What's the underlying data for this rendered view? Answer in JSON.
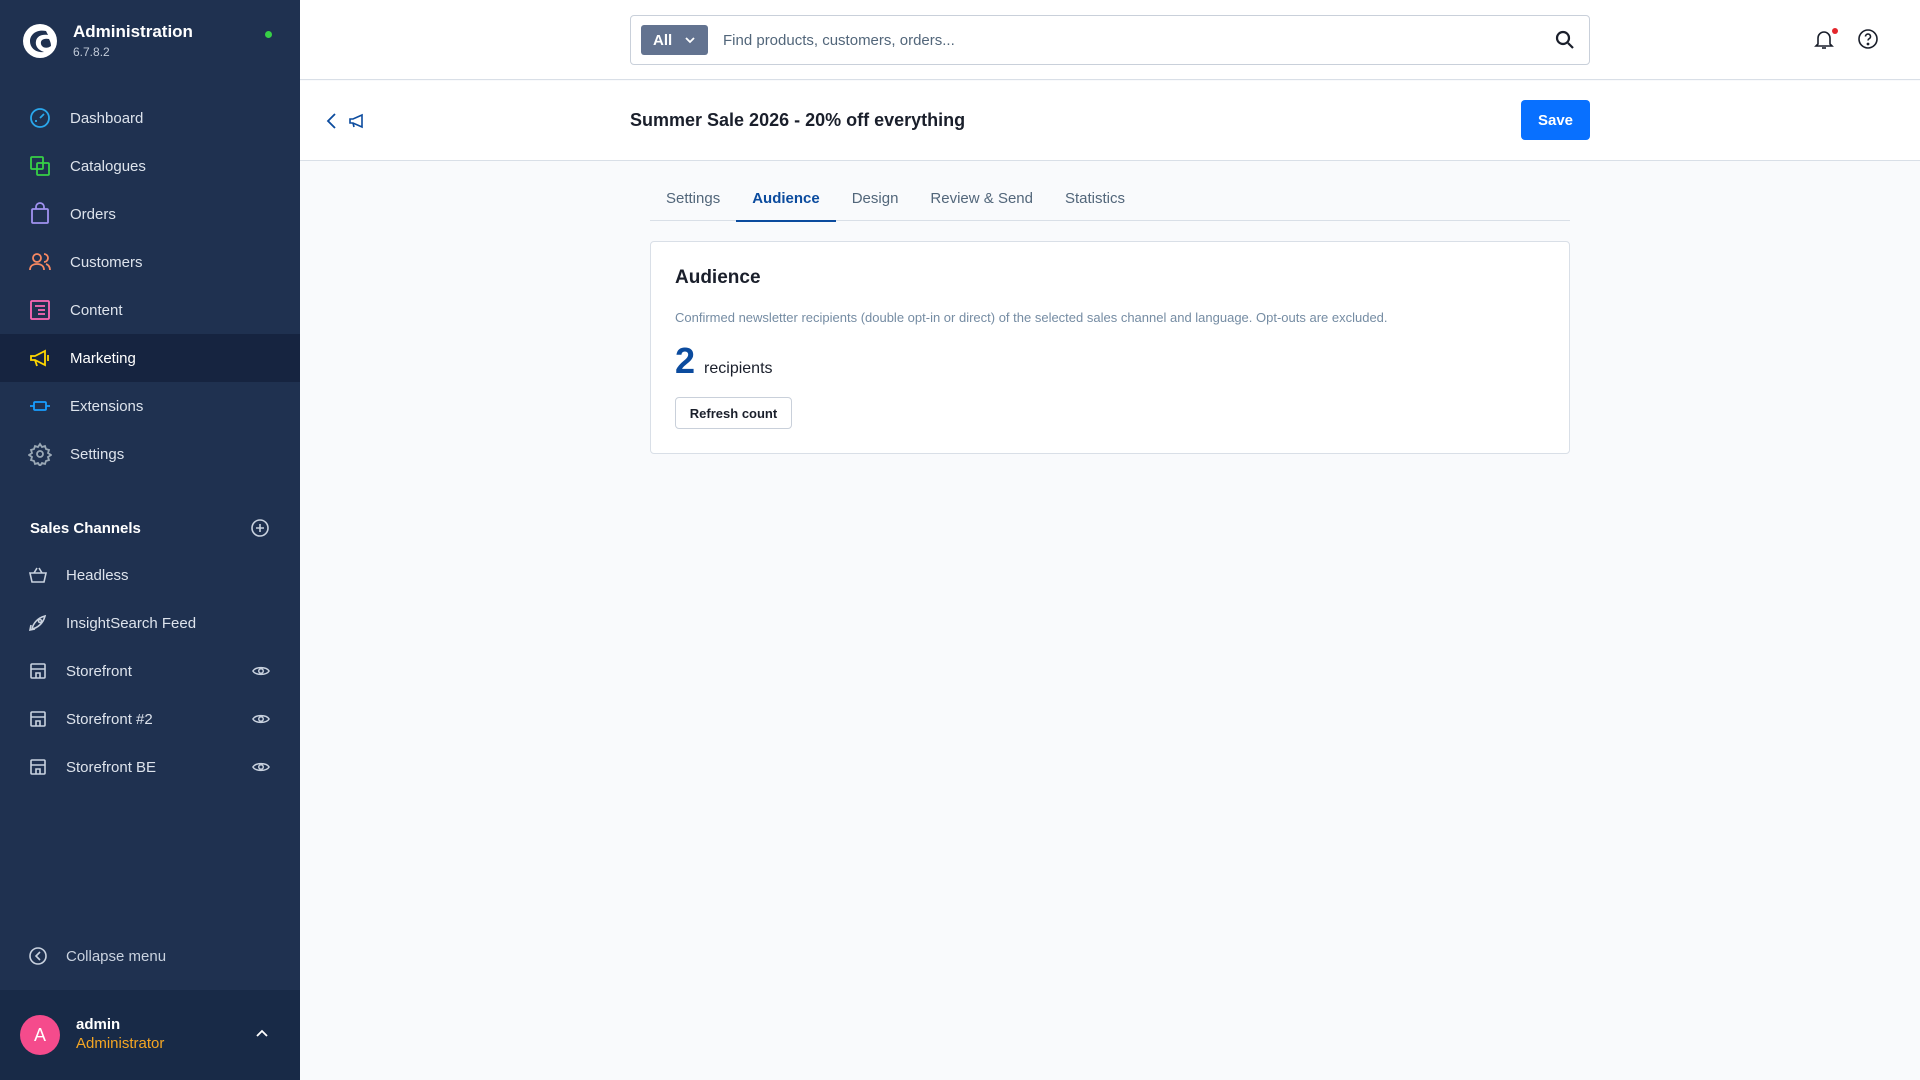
{
  "app": {
    "title": "Administration",
    "version": "6.7.8.2"
  },
  "sidebar": {
    "items": [
      {
        "label": "Dashboard",
        "icon": "dashboard-icon",
        "color": "#2aa7ec"
      },
      {
        "label": "Catalogues",
        "icon": "catalogues-icon",
        "color": "#37d046"
      },
      {
        "label": "Orders",
        "icon": "orders-icon",
        "color": "#a092f0"
      },
      {
        "label": "Customers",
        "icon": "customers-icon",
        "color": "#f88962"
      },
      {
        "label": "Content",
        "icon": "content-icon",
        "color": "#ff68b4"
      },
      {
        "label": "Marketing",
        "icon": "marketing-icon",
        "color": "#ffd700",
        "active": true
      },
      {
        "label": "Extensions",
        "icon": "extensions-icon",
        "color": "#189eff"
      },
      {
        "label": "Settings",
        "icon": "settings-icon",
        "color": "#9aa8b5"
      }
    ],
    "sales_channels_title": "Sales Channels",
    "sales_channels": [
      {
        "label": "Headless",
        "icon": "basket-icon",
        "has_eye": false
      },
      {
        "label": "InsightSearch Feed",
        "icon": "rocket-icon",
        "has_eye": false
      },
      {
        "label": "Storefront",
        "icon": "storefront-icon",
        "has_eye": true
      },
      {
        "label": "Storefront #2",
        "icon": "storefront-icon",
        "has_eye": true
      },
      {
        "label": "Storefront BE",
        "icon": "storefront-icon",
        "has_eye": true
      }
    ],
    "collapse_label": "Collapse menu",
    "user": {
      "initial": "A",
      "name": "admin",
      "role": "Administrator"
    }
  },
  "search": {
    "type_label": "All",
    "placeholder": "Find products, customers, orders..."
  },
  "page": {
    "title": "Summer Sale 2026 - 20% off everything",
    "save_label": "Save"
  },
  "tabs": [
    "Settings",
    "Audience",
    "Design",
    "Review & Send",
    "Statistics"
  ],
  "active_tab": "Audience",
  "audience": {
    "title": "Audience",
    "description": "Confirmed newsletter recipients (double opt-in or direct) of the selected sales channel and language. Opt-outs are excluded.",
    "count": "2",
    "count_label": "recipients",
    "refresh_label": "Refresh count"
  }
}
